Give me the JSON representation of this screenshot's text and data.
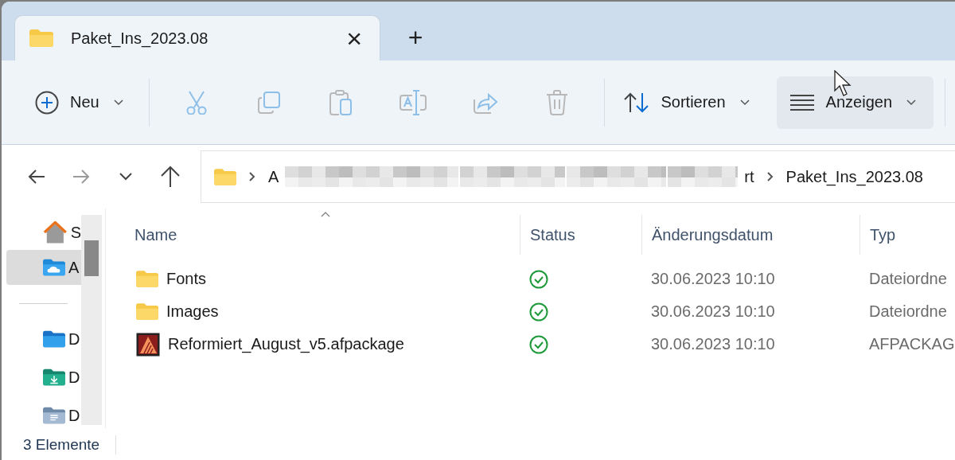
{
  "tabs": [
    {
      "label": "Paket_Ins_2023.08",
      "selected": true,
      "close": "×"
    },
    {
      "label": "+",
      "selected": false,
      "kind": "new"
    }
  ],
  "toolbar": [
    {
      "kind": "dropdown",
      "label": "Neu",
      "hovered": false
    },
    {
      "kind": "separator"
    },
    {
      "kind": "action",
      "disabled": true
    },
    {
      "kind": "action",
      "disabled": true
    },
    {
      "kind": "action",
      "disabled": true
    },
    {
      "kind": "action",
      "disabled": true
    },
    {
      "kind": "action",
      "disabled": true
    },
    {
      "kind": "action",
      "disabled": true
    },
    {
      "kind": "separator"
    },
    {
      "kind": "dropdown",
      "label": "Sortieren",
      "hovered": false
    },
    {
      "kind": "dropdown",
      "label": "Anzeigen",
      "hovered": true
    },
    {
      "kind": "separator"
    }
  ],
  "nav": [
    {
      "disabled": false
    },
    {
      "disabled": true
    },
    {
      "disabled": false
    },
    {
      "disabled": false
    }
  ],
  "address": {
    "segments": [
      {
        "kind": "text",
        "text": "A"
      },
      {
        "kind": "blur"
      },
      {
        "kind": "blur"
      },
      {
        "kind": "blur"
      },
      {
        "kind": "blur"
      },
      {
        "kind": "text",
        "text": "rt"
      },
      {
        "kind": "chevron"
      },
      {
        "kind": "text",
        "text": "Paket_Ins_2023.08"
      }
    ]
  },
  "sidebar": {
    "items": [
      {
        "label": "S",
        "selected": false
      },
      {
        "label": "A",
        "selected": true
      },
      {
        "kind": "divider"
      },
      {
        "label": "D",
        "selected": false
      },
      {
        "label": "D",
        "selected": false
      },
      {
        "label": "D",
        "selected": false
      }
    ]
  },
  "table": {
    "columns": [
      {
        "label": "Name",
        "sorted": true
      },
      {
        "label": "Status",
        "sorted": false
      },
      {
        "label": "Änderungsdatum",
        "sorted": false
      },
      {
        "label": "Typ",
        "sorted": false
      }
    ],
    "rows": [
      {
        "kind": "folder",
        "name": "Fonts",
        "synced": true,
        "date": "30.06.2023 10:10",
        "type": "Dateiordne"
      },
      {
        "kind": "folder",
        "name": "Images",
        "synced": true,
        "date": "30.06.2023 10:10",
        "type": "Dateiordne"
      },
      {
        "kind": "file",
        "name": "Reformiert_August_v5.afpackage",
        "synced": true,
        "date": "30.06.2023 10:10",
        "type": "AFPACKAG"
      }
    ]
  },
  "status_bar": {
    "count": "3 Elemente"
  }
}
